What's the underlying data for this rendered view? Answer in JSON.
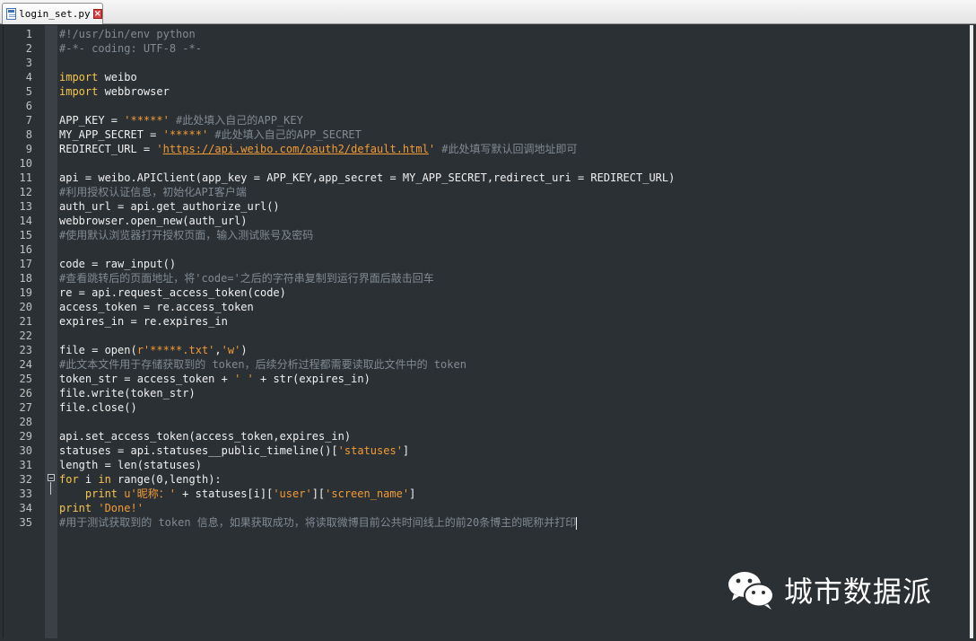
{
  "tab": {
    "filename": "login_set.py",
    "close_glyph": "×"
  },
  "lines": [
    [
      {
        "t": "#!/usr/bin/env python",
        "c": "cm"
      }
    ],
    [
      {
        "t": "#-*- coding: UTF-8 -*-",
        "c": "cm"
      }
    ],
    [],
    [
      {
        "t": "import",
        "c": "kw"
      },
      {
        "t": " weibo"
      }
    ],
    [
      {
        "t": "import",
        "c": "kw"
      },
      {
        "t": " webbrowser"
      }
    ],
    [],
    [
      {
        "t": "APP_KEY = "
      },
      {
        "t": "'*****'",
        "c": "st"
      },
      {
        "t": " #此处填入自己的APP_KEY",
        "c": "cm"
      }
    ],
    [
      {
        "t": "MY_APP_SECRET = "
      },
      {
        "t": "'*****'",
        "c": "st"
      },
      {
        "t": " #此处填入自己的APP_SECRET",
        "c": "cm"
      }
    ],
    [
      {
        "t": "REDIRECT_URL = "
      },
      {
        "t": "'",
        "c": "st"
      },
      {
        "t": "https://api.weibo.com/oauth2/default.html",
        "c": "url"
      },
      {
        "t": "'",
        "c": "st"
      },
      {
        "t": " #此处填写默认回调地址即可",
        "c": "cm"
      }
    ],
    [],
    [
      {
        "t": "api = weibo.APIClient(app_key = APP_KEY,app_secret = MY_APP_SECRET,redirect_uri = REDIRECT_URL)"
      }
    ],
    [
      {
        "t": "#利用授权认证信息，初始化API客户端",
        "c": "cm"
      }
    ],
    [
      {
        "t": "auth_url = api.get_authorize_url()"
      }
    ],
    [
      {
        "t": "webbrowser.open_new(auth_url)"
      }
    ],
    [
      {
        "t": "#使用默认浏览器打开授权页面，输入测试账号及密码",
        "c": "cm"
      }
    ],
    [],
    [
      {
        "t": "code = raw_input()"
      }
    ],
    [
      {
        "t": "#查看跳转后的页面地址，将'code='之后的字符串复制到运行界面后敲击回车",
        "c": "cm"
      }
    ],
    [
      {
        "t": "re = api.request_access_token(code)"
      }
    ],
    [
      {
        "t": "access_token = re.access_token"
      }
    ],
    [
      {
        "t": "expires_in = re.expires_in"
      }
    ],
    [],
    [
      {
        "t": "file = open("
      },
      {
        "t": "r'*****.txt'",
        "c": "st"
      },
      {
        "t": ","
      },
      {
        "t": "'w'",
        "c": "st"
      },
      {
        "t": ")"
      }
    ],
    [
      {
        "t": "#此文本文件用于存储获取到的 token，后续分析过程都需要读取此文件中的 token",
        "c": "cm"
      }
    ],
    [
      {
        "t": "token_str = access_token + "
      },
      {
        "t": "' '",
        "c": "st"
      },
      {
        "t": " + str(expires_in)"
      }
    ],
    [
      {
        "t": "file.write(token_str)"
      }
    ],
    [
      {
        "t": "file.close()"
      }
    ],
    [],
    [
      {
        "t": "api.set_access_token(access_token,expires_in)"
      }
    ],
    [
      {
        "t": "statuses = api.statuses__public_timeline()["
      },
      {
        "t": "'statuses'",
        "c": "st"
      },
      {
        "t": "]"
      }
    ],
    [
      {
        "t": "length = len(statuses)"
      }
    ],
    [
      {
        "t": "for",
        "c": "kw"
      },
      {
        "t": " i "
      },
      {
        "t": "in",
        "c": "kw"
      },
      {
        "t": " range(0,length):"
      }
    ],
    [
      {
        "t": "    "
      },
      {
        "t": "print",
        "c": "kw"
      },
      {
        "t": " "
      },
      {
        "t": "u'昵称：'",
        "c": "st"
      },
      {
        "t": " + statuses[i]["
      },
      {
        "t": "'user'",
        "c": "st"
      },
      {
        "t": "]["
      },
      {
        "t": "'screen_name'",
        "c": "st"
      },
      {
        "t": "]"
      }
    ],
    [
      {
        "t": "print",
        "c": "kw"
      },
      {
        "t": " "
      },
      {
        "t": "'Done!'",
        "c": "st"
      }
    ],
    [
      {
        "t": "#用于测试获取到的 token 信息，如果获取成功，将读取微博目前公共时间线上的前20条博主的昵称并打印",
        "c": "cm"
      }
    ]
  ],
  "line_numbers": [
    "1",
    "2",
    "3",
    "4",
    "5",
    "6",
    "7",
    "8",
    "9",
    "10",
    "11",
    "12",
    "13",
    "14",
    "15",
    "16",
    "17",
    "18",
    "19",
    "20",
    "21",
    "22",
    "23",
    "24",
    "25",
    "26",
    "27",
    "28",
    "29",
    "30",
    "31",
    "32",
    "33",
    "34",
    "35"
  ],
  "watermark": {
    "text": "城市数据派",
    "icon": "wechat-icon"
  },
  "colors": {
    "background": "#2b3034",
    "comment": "#808b94",
    "keyword": "#f7c54b",
    "string": "#f39b35",
    "text": "#f0f0f0"
  }
}
